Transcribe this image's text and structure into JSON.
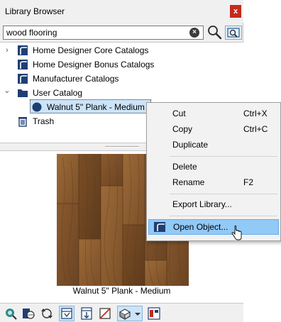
{
  "window": {
    "title": "Library Browser",
    "close_glyph": "x"
  },
  "search": {
    "value": "wood flooring",
    "clear_glyph": "×"
  },
  "tree": {
    "items": [
      {
        "label": "Home Designer Core Catalogs",
        "icon": "catalog-icon",
        "expander": "›"
      },
      {
        "label": "Home Designer Bonus Catalogs",
        "icon": "catalog-icon",
        "expander": ""
      },
      {
        "label": "Manufacturer Catalogs",
        "icon": "catalog-icon",
        "expander": ""
      },
      {
        "label": "User Catalog",
        "icon": "folder-icon",
        "expander": "⌄"
      },
      {
        "label": "Walnut 5\" Plank - Medium",
        "icon": "material-icon",
        "expander": ""
      },
      {
        "label": "Trash",
        "icon": "trash-icon",
        "expander": ""
      }
    ]
  },
  "preview": {
    "caption": "Walnut 5\" Plank - Medium"
  },
  "context_menu": {
    "items": [
      {
        "label": "Cut",
        "shortcut": "Ctrl+X"
      },
      {
        "label": "Copy",
        "shortcut": "Ctrl+C"
      },
      {
        "label": "Duplicate",
        "shortcut": ""
      },
      {
        "label": "Delete",
        "shortcut": ""
      },
      {
        "label": "Rename",
        "shortcut": "F2"
      },
      {
        "label": "Export Library...",
        "shortcut": ""
      },
      {
        "label": "Open Object...",
        "shortcut": ""
      }
    ],
    "highlighted": "Open Object..."
  },
  "colors": {
    "selection": "#cce4f7",
    "menu_highlight": "#91c9f7",
    "close_button": "#c42b1c",
    "catalog_icon": "#1f3f73"
  }
}
